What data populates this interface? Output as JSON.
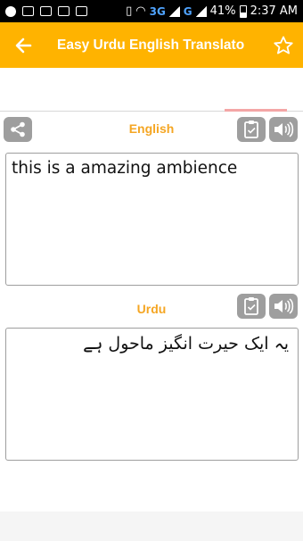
{
  "status_bar": {
    "network": "3G",
    "network2": "G",
    "battery": "41%",
    "time": "2:37 AM"
  },
  "app_bar": {
    "title": "Easy Urdu English Translator",
    "back_icon": "arrow-left-icon",
    "star_icon": "star-outline-icon"
  },
  "source": {
    "language_label": "English",
    "text": "this is a amazing ambience"
  },
  "target": {
    "language_label": "Urdu",
    "text": "یہ ایک حیرت انگیز ماحول ہے"
  },
  "colors": {
    "accent": "#ffb300",
    "label": "#f5a623",
    "button": "#9e9e9e"
  }
}
